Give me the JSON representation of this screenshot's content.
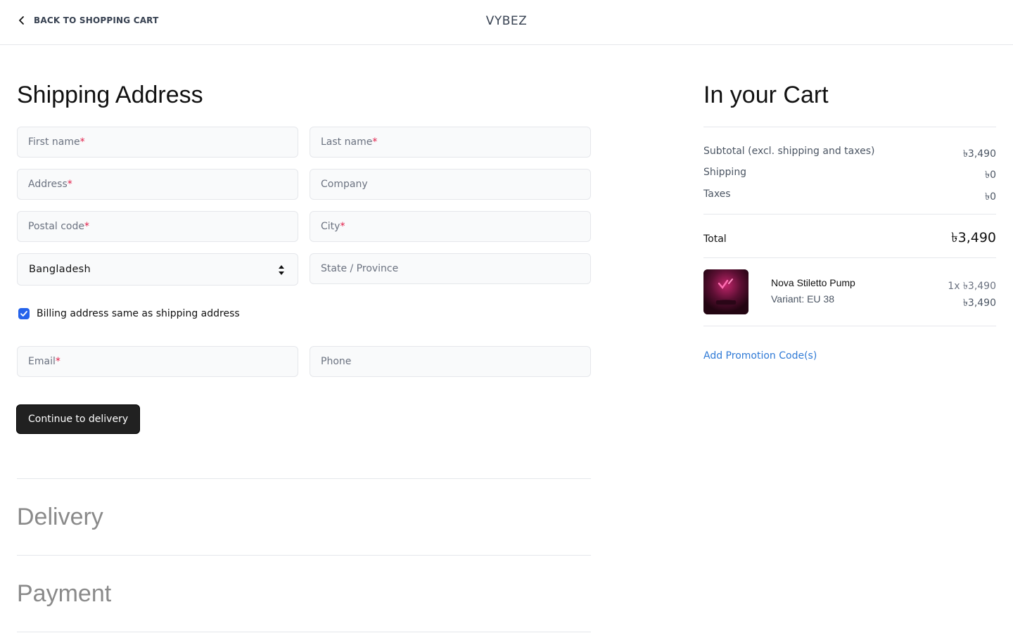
{
  "header": {
    "back_label": "BACK TO SHOPPING CART",
    "brand": "VYBEZ"
  },
  "shipping": {
    "title": "Shipping Address",
    "fields": {
      "first_name": "First name",
      "last_name": "Last name",
      "address": "Address",
      "company": "Company",
      "postal_code": "Postal code",
      "city": "City",
      "country_value": "Bangladesh",
      "state": "State / Province",
      "email": "Email",
      "phone": "Phone"
    },
    "required_mark": "*",
    "billing_same_label": "Billing address same as shipping address",
    "billing_same_checked": true,
    "continue_label": "Continue to delivery"
  },
  "steps": {
    "delivery": "Delivery",
    "payment": "Payment"
  },
  "cart": {
    "title": "In your Cart",
    "subtotal_label": "Subtotal (excl. shipping and taxes)",
    "subtotal_value": "৳3,490",
    "shipping_label": "Shipping",
    "shipping_value": "৳0",
    "taxes_label": "Taxes",
    "taxes_value": "৳0",
    "total_label": "Total",
    "total_value": "৳3,490",
    "items": [
      {
        "name": "Nova Stiletto Pump",
        "variant": "Variant: EU 38",
        "quantity": "1x ৳3,490",
        "price": "৳3,490"
      }
    ],
    "promo_label": "Add Promotion Code(s)"
  },
  "colors": {
    "accent_link": "#2f7ad6",
    "required": "#e11d48",
    "button_bg": "#212121",
    "checkbox": "#2563eb"
  }
}
